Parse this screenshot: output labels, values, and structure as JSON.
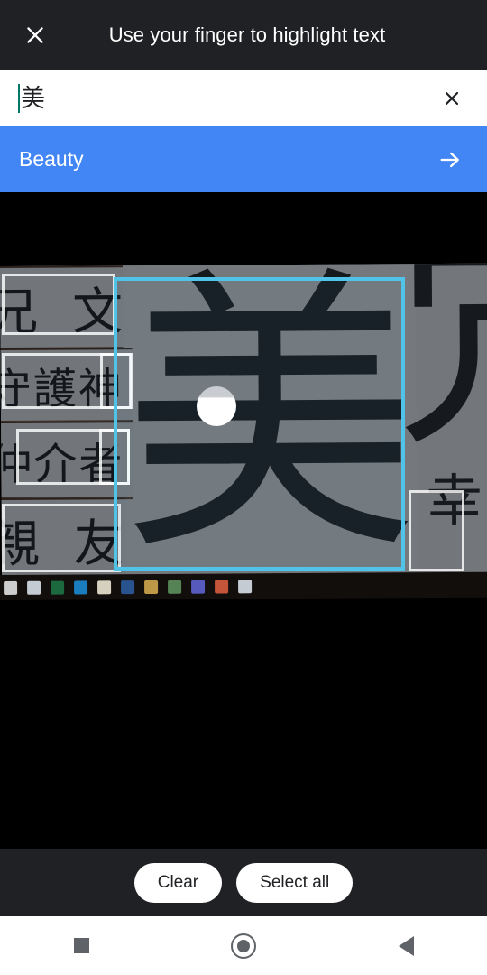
{
  "header": {
    "title": "Use your finger to highlight text",
    "close_icon": "close-icon"
  },
  "source_input": {
    "value": "美",
    "placeholder": "",
    "clear_icon": "close-icon",
    "caret_color": "#00796b"
  },
  "translation": {
    "text": "Beauty",
    "arrow_icon": "arrow-right-icon",
    "background_color": "#4285f4"
  },
  "camera_view": {
    "selection_color": "#4fc3e8",
    "ocr_box_color": "#ffffff",
    "touch_indicator": "touch-point",
    "detected_text": {
      "main_character": "美",
      "left_column": [
        {
          "text": "兄 文"
        },
        {
          "text": "守護神"
        },
        {
          "text": "仲介者"
        },
        {
          "text": "親 友"
        }
      ],
      "right_column": [
        {
          "text": "冗"
        },
        {
          "text": "幸"
        }
      ]
    },
    "taskbar_icons": [
      {
        "name": "app-icon-1",
        "color": "#d8d8d8"
      },
      {
        "name": "app-icon-2",
        "color": "#cfd6dd"
      },
      {
        "name": "app-icon-excel",
        "color": "#1d6f42"
      },
      {
        "name": "app-icon-edge",
        "color": "#1b84c8"
      },
      {
        "name": "app-icon-5",
        "color": "#e0dcc8"
      },
      {
        "name": "app-icon-word",
        "color": "#2b5797"
      },
      {
        "name": "app-icon-explorer",
        "color": "#c8a04a"
      },
      {
        "name": "app-icon-onenote",
        "color": "#5a8a5a"
      },
      {
        "name": "app-icon-teams",
        "color": "#5b5fc7"
      },
      {
        "name": "app-icon-chrome",
        "color": "#cf5a3e"
      },
      {
        "name": "app-icon-11",
        "color": "#cfd6dd"
      }
    ]
  },
  "actions": {
    "clear_label": "Clear",
    "select_all_label": "Select all"
  },
  "navbar": {
    "recents_icon": "square-icon",
    "home_icon": "circle-icon",
    "back_icon": "triangle-left-icon"
  }
}
